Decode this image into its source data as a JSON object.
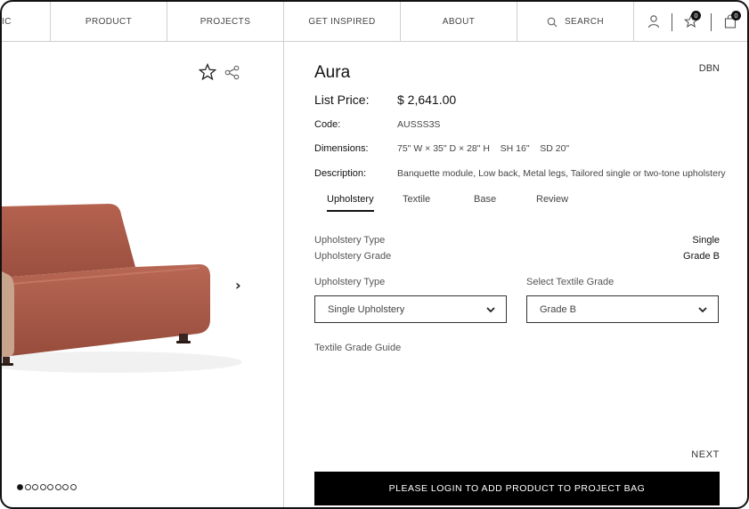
{
  "nav": {
    "items": [
      "IC",
      "PRODUCT",
      "PROJECTS",
      "GET INSPIRED",
      "ABOUT"
    ],
    "search_label": "SEARCH",
    "favorites_count": "0",
    "bag_count": "0"
  },
  "gallery": {
    "next_glyph": "›",
    "slide_count": 8,
    "active_slide": 1
  },
  "product": {
    "name": "Aura",
    "brand_code": "DBN",
    "price_label": "List Price:",
    "price": "$  2,641.00",
    "code_label": "Code:",
    "code": "AUSSS3S",
    "dimensions_label": "Dimensions:",
    "dimensions": "75\" W × 35\" D × 28\" H    SH 16\"    SD 20\"",
    "description_label": "Description:",
    "description": "Banquette module, Low back, Metal legs, Tailored single or two-tone upholstery"
  },
  "tabs": [
    "Upholstery",
    "Textile",
    "Base",
    "Review"
  ],
  "summary": {
    "type_label": "Upholstery Type",
    "type_value": "Single",
    "grade_label": "Upholstery Grade",
    "grade_value": "Grade B"
  },
  "selects": {
    "upholstery_label": "Upholstery Type",
    "upholstery_value": "Single Upholstery",
    "textile_label": "Select Textile Grade",
    "textile_value": "Grade B"
  },
  "textile_guide": "Textile Grade Guide",
  "next_label": "NEXT",
  "cta_label": "PLEASE LOGIN TO ADD PRODUCT TO PROJECT BAG",
  "colors": {
    "sofa": "#a85a48",
    "accent": "#000000"
  }
}
